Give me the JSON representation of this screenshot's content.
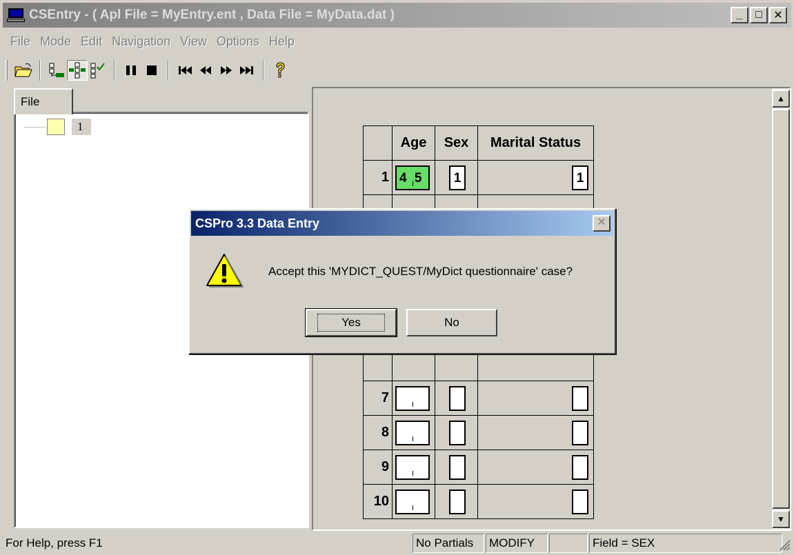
{
  "window": {
    "title": "CSEntry - ( Apl File = MyEntry.ent , Data File = MyData.dat )",
    "controls": {
      "minimize": "_",
      "maximize": "□",
      "close": "✕"
    }
  },
  "menu": [
    "File",
    "Mode",
    "Edit",
    "Navigation",
    "View",
    "Options",
    "Help"
  ],
  "toolbar": {
    "open": "📂",
    "add_case": "⊞",
    "modify_case": "⊕",
    "verify_case": "✓",
    "pause": "❚❚",
    "stop": "■",
    "first": "⏮",
    "previous": "◀◀",
    "next": "▶▶",
    "last": "⏭",
    "help": "?"
  },
  "tree": {
    "tab": "File",
    "node_label": "1"
  },
  "roster": {
    "headers": [
      "Age",
      "Sex",
      "Marital Status"
    ],
    "rows": [
      {
        "n": "1",
        "age": "4 5",
        "sex": "1",
        "ms": "1"
      },
      {
        "n": "7",
        "age": "",
        "sex": "",
        "ms": ""
      },
      {
        "n": "8",
        "age": "",
        "sex": "",
        "ms": ""
      },
      {
        "n": "9",
        "age": "",
        "sex": "",
        "ms": ""
      },
      {
        "n": "10",
        "age": "",
        "sex": "",
        "ms": ""
      }
    ]
  },
  "dialog": {
    "title": "CSPro 3.3 Data Entry",
    "message": "Accept this 'MYDICT_QUEST/MyDict questionnaire' case?",
    "yes": "Yes",
    "no": "No",
    "close": "✕"
  },
  "status": {
    "help": "For Help, press F1",
    "partials": "No Partials",
    "mode": "MODIFY",
    "empty": "",
    "field": "Field = SEX"
  }
}
